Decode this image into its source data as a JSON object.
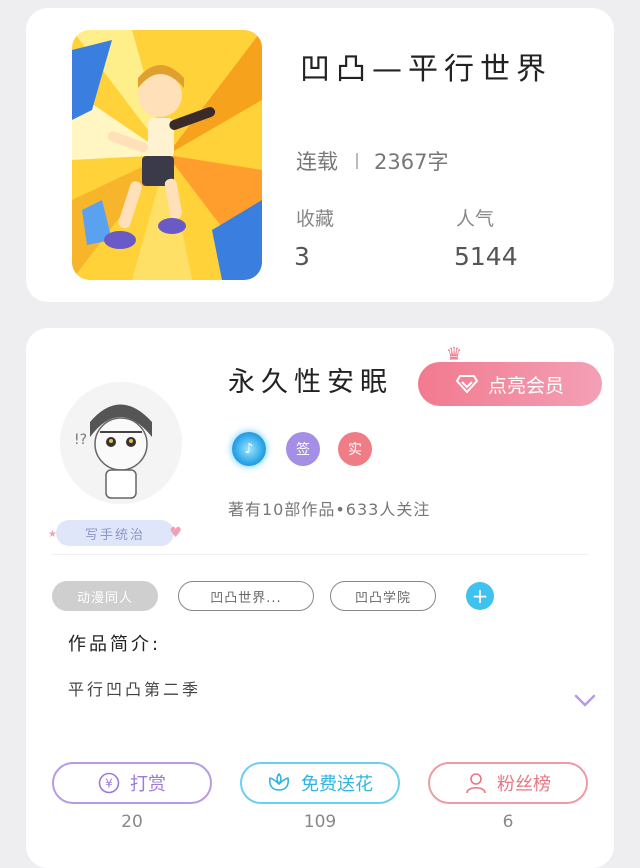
{
  "book": {
    "title": "凹凸—平行世界",
    "status": "连载",
    "word_count": "2367字",
    "favorites_label": "收藏",
    "favorites_value": "3",
    "popularity_label": "人气",
    "popularity_value": "5144"
  },
  "author": {
    "name": "永久性安眠",
    "tag": "写手统治",
    "vip_button": "点亮会员",
    "badges": {
      "music": "♪",
      "sign": "签",
      "real": "实"
    },
    "stats": "著有10部作品•633人关注"
  },
  "tags": [
    "动漫同人",
    "凹凸世界...",
    "凹凸学院"
  ],
  "intro": {
    "label": "作品简介:",
    "text": "平行凹凸第二季"
  },
  "actions": [
    {
      "label": "打赏",
      "count": "20"
    },
    {
      "label": "免费送花",
      "count": "109"
    },
    {
      "label": "粉丝榜",
      "count": "6"
    }
  ],
  "colors": {
    "vip_gradient_start": "#f27a8e",
    "vip_gradient_end": "#f3a0b6",
    "reward": "#9d7ad8",
    "flower": "#32b4e2",
    "fans": "#e87784",
    "add_tag": "#3fc2f0"
  },
  "icons": {
    "vip": "diamond-icon",
    "add": "plus-icon",
    "expand": "chevron-down-icon",
    "reward": "yen-coin-icon",
    "flower": "flower-icon",
    "fans": "user-icon"
  }
}
